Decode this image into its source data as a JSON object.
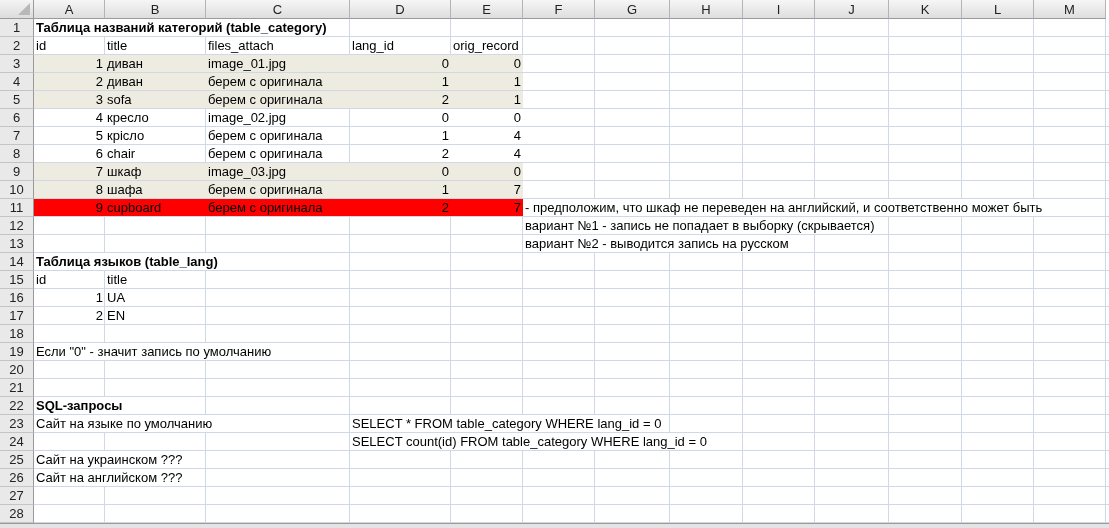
{
  "columns": [
    "A",
    "B",
    "C",
    "D",
    "E",
    "F",
    "G",
    "H",
    "I",
    "J",
    "K",
    "L",
    "M"
  ],
  "row_numbers": [
    "1",
    "2",
    "3",
    "4",
    "5",
    "6",
    "7",
    "8",
    "9",
    "10",
    "11",
    "12",
    "13",
    "14",
    "15",
    "16",
    "17",
    "18",
    "19",
    "20",
    "21",
    "22",
    "23",
    "24",
    "25",
    "26",
    "27",
    "28"
  ],
  "category_table": {
    "title": "Таблица названий категорий (table_category)",
    "columns": [
      "id",
      "title",
      "files_attach",
      "lang_id",
      "orig_record"
    ],
    "rows": [
      {
        "id": "1",
        "title": "диван",
        "files_attach": "image_01.jpg",
        "lang_id": "0",
        "orig_record": "0",
        "color": "#eeebe1"
      },
      {
        "id": "2",
        "title": "диван",
        "files_attach": "берем с оригинала",
        "lang_id": "1",
        "orig_record": "1",
        "color": "#eeebe1"
      },
      {
        "id": "3",
        "title": "sofa",
        "files_attach": "берем с оригинала",
        "lang_id": "2",
        "orig_record": "1",
        "color": "#eeebe1"
      },
      {
        "id": "4",
        "title": "кресло",
        "files_attach": "image_02.jpg",
        "lang_id": "0",
        "orig_record": "0"
      },
      {
        "id": "5",
        "title": "крісло",
        "files_attach": "берем с оригинала",
        "lang_id": "1",
        "orig_record": "4"
      },
      {
        "id": "6",
        "title": "chair",
        "files_attach": "берем с оригинала",
        "lang_id": "2",
        "orig_record": "4"
      },
      {
        "id": "7",
        "title": "шкаф",
        "files_attach": "image_03.jpg",
        "lang_id": "0",
        "orig_record": "0",
        "color": "#eeebe1"
      },
      {
        "id": "8",
        "title": "шафа",
        "files_attach": "берем с оригинала",
        "lang_id": "1",
        "orig_record": "7",
        "color": "#eeebe1"
      },
      {
        "id": "9",
        "title": "cupboard",
        "files_attach": "берем с оригинала",
        "lang_id": "2",
        "orig_record": "7",
        "color": "#ff0000"
      }
    ]
  },
  "notes": [
    "- предположим, что шкаф не переведен на английский, и соответственно может быть",
    "вариант №1 - запись не попадает в выборку (скрывается)",
    "вариант №2 - выводится запись на русском"
  ],
  "lang_table": {
    "title": "Таблица языков (table_lang)",
    "columns": [
      "id",
      "title"
    ],
    "rows": [
      {
        "id": "1",
        "title": "UA"
      },
      {
        "id": "2",
        "title": "EN"
      }
    ]
  },
  "default_note": "Если \"0\" - значит запись по умолчанию",
  "sql": {
    "title": "SQL-запросы",
    "items": [
      {
        "label": "Сайт на языке по умолчанию",
        "queries": [
          "SELECT * FROM table_category WHERE lang_id = 0",
          "SELECT count(id) FROM table_category WHERE lang_id = 0"
        ]
      },
      {
        "label": "Сайт на украинском ???"
      },
      {
        "label": "Сайт на английском ???"
      }
    ]
  }
}
